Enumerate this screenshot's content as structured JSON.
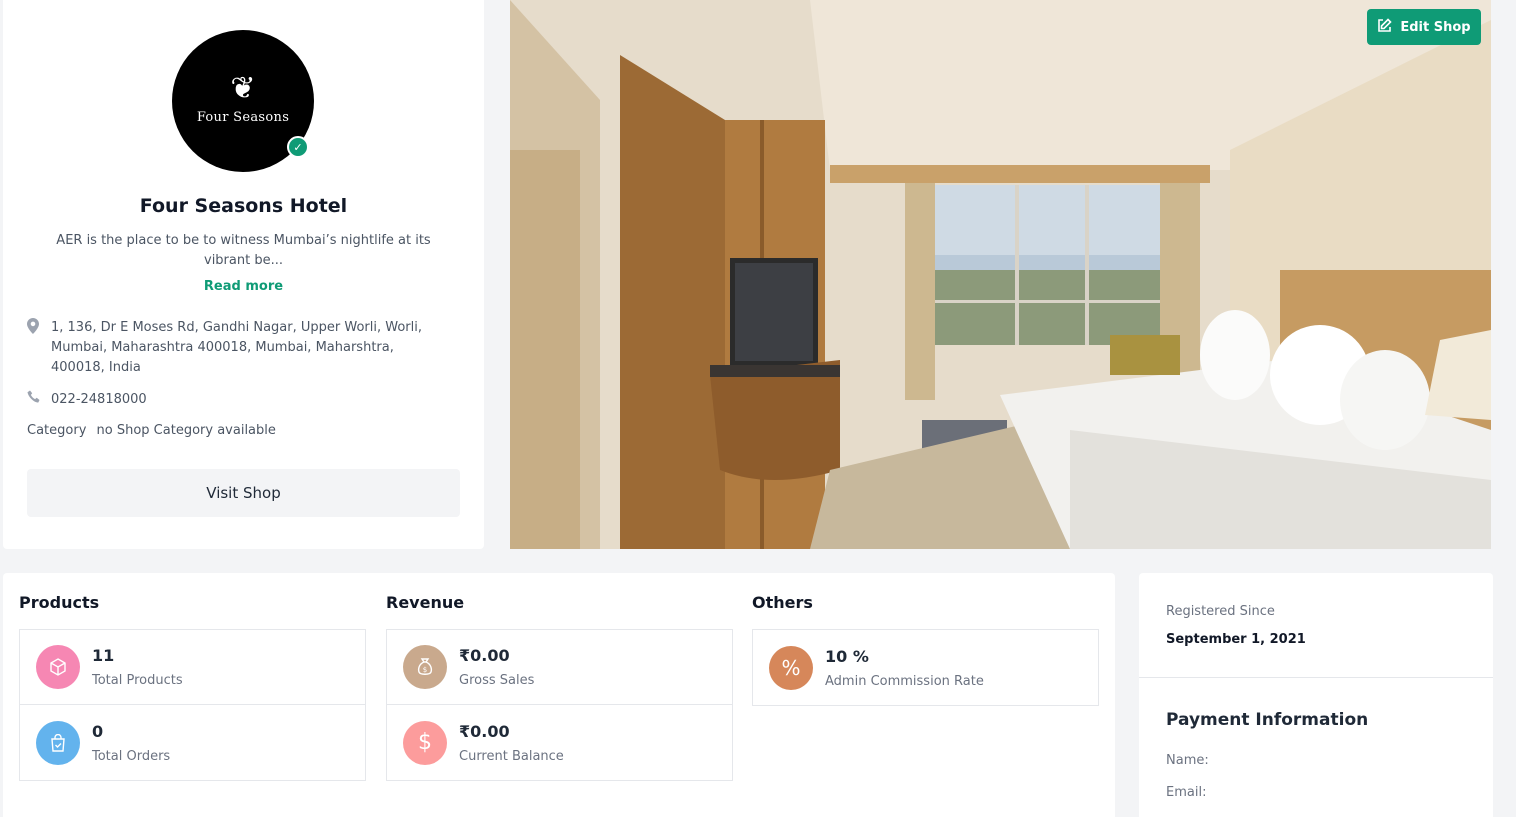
{
  "profile": {
    "logo_text": "Four Seasons",
    "logo_icon": "tree-emblem-icon",
    "verified_icon": "check-circle-icon",
    "shop_name": "Four Seasons Hotel",
    "description": "AER is the place to be to witness Mumbai’s nightlife at its vibrant be...",
    "read_more": "Read more",
    "address_icon": "map-pin-icon",
    "address": "1, 136, Dr E Moses Rd, Gandhi Nagar, Upper Worli, Worli, Mumbai, Maharashtra 400018, Mumbai, Maharshtra, 400018, India",
    "phone_icon": "phone-icon",
    "phone": "022-24818000",
    "category_label": "Category",
    "category_value": "no Shop Category available",
    "visit_shop": "Visit Shop"
  },
  "header": {
    "edit_shop": "Edit Shop",
    "edit_icon": "edit-square-icon",
    "brand_color": "#0f9b76"
  },
  "stats": {
    "products": {
      "title": "Products",
      "items": [
        {
          "value": "11",
          "label": "Total Products",
          "icon": "box-icon",
          "color": "#f687b3"
        },
        {
          "value": "0",
          "label": "Total Orders",
          "icon": "shopping-bag-icon",
          "color": "#63b3ed"
        }
      ]
    },
    "revenue": {
      "title": "Revenue",
      "items": [
        {
          "value": "₹0.00",
          "label": "Gross Sales",
          "icon": "money-bag-icon",
          "color": "#c9a98d"
        },
        {
          "value": "₹0.00",
          "label": "Current Balance",
          "icon": "dollar-icon",
          "color": "#fc9c9c"
        }
      ]
    },
    "others": {
      "title": "Others",
      "items": [
        {
          "value": "10 %",
          "label": "Admin Commission Rate",
          "icon": "percent-icon",
          "color": "#d6875a"
        }
      ]
    }
  },
  "info": {
    "registered_label": "Registered Since",
    "registered_value": "September 1, 2021",
    "payment_title": "Payment Information",
    "name_label": "Name:",
    "email_label": "Email:"
  }
}
